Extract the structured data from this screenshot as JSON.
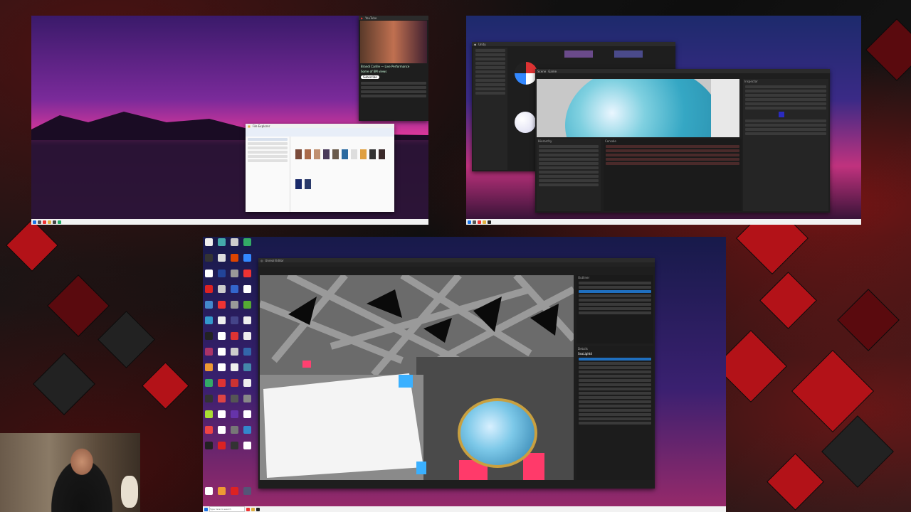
{
  "monitor_left": {
    "taskbar_clock": "",
    "browser_window": {
      "site_name": "YouTube",
      "video_title": "Brandi Carlile — Live Performance",
      "channel_line": "Some of 6M views",
      "subscribe_label": "Subscribe"
    },
    "explorer_window": {
      "title": "File Explorer"
    }
  },
  "monitor_right": {
    "editor_window": {
      "title": "Unity",
      "panels": [
        "Hierarchy",
        "Scene",
        "Game",
        "Inspector",
        "Console"
      ]
    }
  },
  "monitor_center": {
    "editor_window": {
      "title": "Unreal Editor",
      "outliner_label": "Outliner",
      "details_label": "Details",
      "selected_actor": "SeaLight4"
    },
    "taskbar_search": "Type here to search"
  },
  "colors": {
    "accent_red": "#b31218",
    "unity_blue": "#35a7c4",
    "ue_selection": "#1f6fbf"
  }
}
